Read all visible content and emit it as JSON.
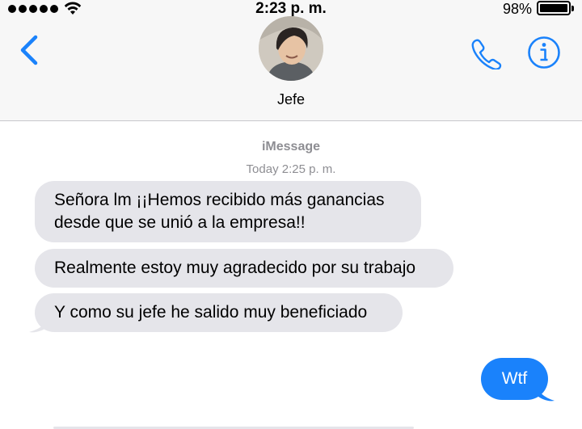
{
  "status_bar": {
    "time": "2:23 p. m.",
    "battery_percent": "98%",
    "signal_bars": 5,
    "wifi_icon": "wifi-icon",
    "battery_level": 0.98
  },
  "header": {
    "back_icon": "chevron-left-icon",
    "contact_name": "Jefe",
    "phone_icon": "phone-icon",
    "info_icon": "info-icon",
    "accent_color": "#1a82fb"
  },
  "conversation": {
    "service": "iMessage",
    "timestamp": "Today 2:25 p. m.",
    "incoming": [
      "Señora lm ¡¡Hemos recibido más ganancias desde que se unió a la empresa!!",
      "Realmente estoy muy agradecido por su trabajo",
      "Y como su jefe he salido muy beneficiado"
    ],
    "outgoing": [
      "Wtf"
    ],
    "incoming_color": "#e5e5ea",
    "outgoing_color": "#1a82fb"
  }
}
